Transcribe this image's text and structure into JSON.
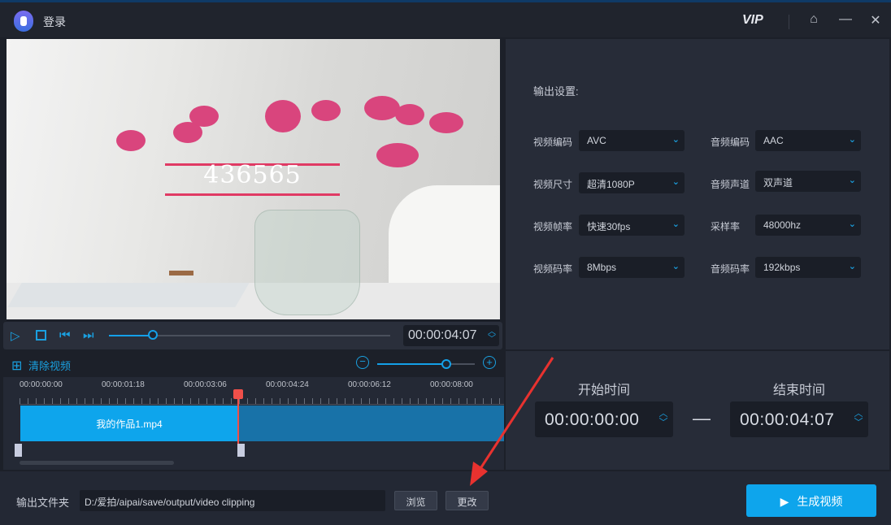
{
  "titlebar": {
    "title": "登录",
    "vip": "VIP",
    "home_icon": "⌂",
    "min_icon": "—",
    "close_icon": "✕"
  },
  "preview": {
    "watermark": "436565"
  },
  "player": {
    "current_time": "00:00:04:07",
    "progress_percent": 15.6
  },
  "toolbar": {
    "clear_label": "清除视频",
    "zoom_percent": 70
  },
  "timeline": {
    "ticks": [
      "00:00:00:00",
      "00:00:01:18",
      "00:00:03:06",
      "00:00:04:24",
      "00:00:06:12",
      "00:00:08:00"
    ],
    "clip_name": "我的作品1.mp4"
  },
  "settings": {
    "heading": "输出设置:",
    "video": [
      {
        "label": "视频编码",
        "value": "AVC"
      },
      {
        "label": "视频尺寸",
        "value": "超清1080P"
      },
      {
        "label": "视频帧率",
        "value": "快速30fps"
      },
      {
        "label": "视频码率",
        "value": "8Mbps"
      }
    ],
    "audio": [
      {
        "label": "音频编码",
        "value": "AAC"
      },
      {
        "label": "音频声道",
        "value": "双声道"
      },
      {
        "label": "采样率",
        "value": "48000hz"
      },
      {
        "label": "音频码率",
        "value": "192kbps"
      }
    ]
  },
  "trim": {
    "start_label": "开始时间",
    "start": "00:00:00:00",
    "dash": "—",
    "end_label": "结束时间",
    "end": "00:00:04:07"
  },
  "output": {
    "label": "输出文件夹",
    "path": "D:/爱拍/aipai/save/output/video clipping",
    "browse": "浏览",
    "change": "更改",
    "generate": "生成视频"
  },
  "colors": {
    "accent": "#0ea5ec",
    "playhead": "#f0504a",
    "annotation": "#e8322f"
  }
}
